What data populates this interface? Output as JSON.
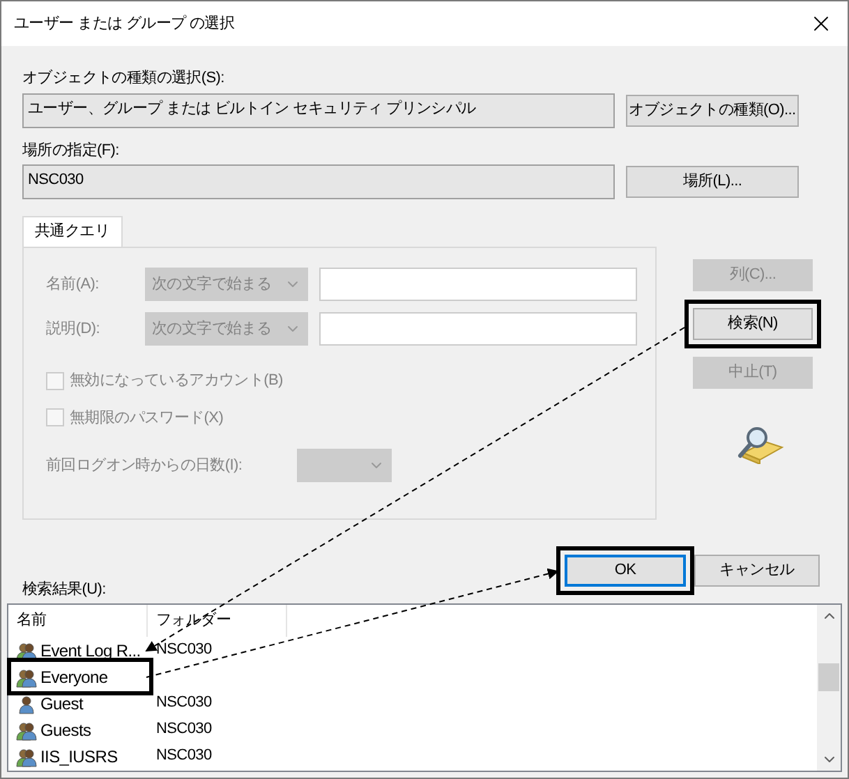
{
  "window": {
    "title": "ユーザー または グループ の選択"
  },
  "object_type": {
    "label": "オブジェクトの種類の選択(S):",
    "value": "ユーザー、グループ または ビルトイン セキュリティ プリンシパル",
    "button": "オブジェクトの種類(O)..."
  },
  "location": {
    "label": "場所の指定(F):",
    "value": "NSC030",
    "button": "場所(L)..."
  },
  "query": {
    "tab": {
      "label": "共通クエリ",
      "selected": true
    },
    "fields": [
      {
        "label": "名前(A):",
        "mode": "次の文字で始まる"
      },
      {
        "label": "説明(D):",
        "mode": "次の文字で始まる"
      }
    ],
    "checkboxes": [
      {
        "label": "無効になっているアカウント(B)",
        "checked": false
      },
      {
        "label": "無期限のパスワード(X)",
        "checked": false
      }
    ],
    "days_label": "前回ログオン時からの日数(I):"
  },
  "side_buttons": [
    {
      "label": "列(C)...",
      "disabled": true,
      "highlighted": false
    },
    {
      "label": "検索(N)",
      "disabled": false,
      "highlighted": true
    },
    {
      "label": "中止(T)",
      "disabled": true,
      "highlighted": false
    }
  ],
  "dialog_buttons": [
    {
      "label": "OK",
      "default": true,
      "highlighted": true
    },
    {
      "label": "キャンセル",
      "default": false,
      "highlighted": false
    }
  ],
  "results": {
    "label": "検索結果(U):",
    "columns": [
      "名前",
      "フォルダー"
    ],
    "rows": [
      {
        "name": "Event Log R...",
        "folder": "NSC030",
        "kind": "group",
        "highlighted": false
      },
      {
        "name": "Everyone",
        "kind": "group",
        "highlighted": true
      },
      {
        "name": "Guest",
        "folder": "NSC030",
        "kind": "user",
        "highlighted": false
      },
      {
        "name": "Guests",
        "folder": "NSC030",
        "kind": "group",
        "highlighted": false
      },
      {
        "name": "IIS_IUSRS",
        "folder": "NSC030",
        "kind": "group",
        "highlighted": false
      }
    ]
  }
}
